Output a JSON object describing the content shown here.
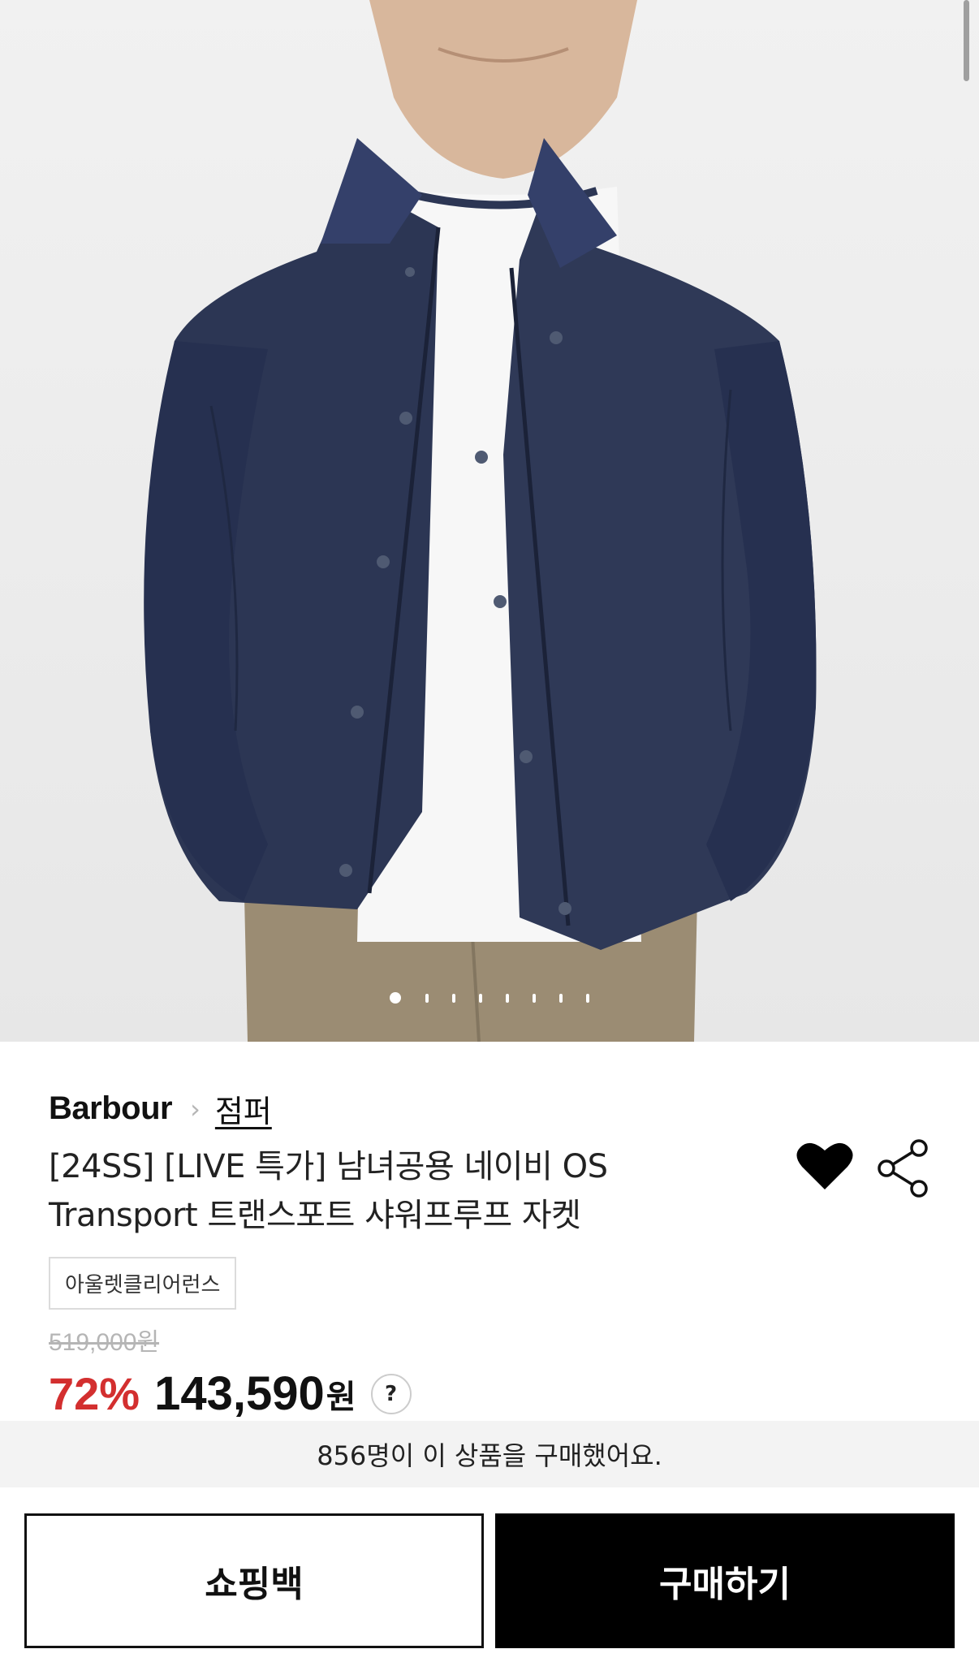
{
  "product": {
    "brand": "Barbour",
    "category": "점퍼",
    "title_line1": "[24SS] [LIVE 특가] 남녀공용 네이비 OS",
    "title_line2": "Transport 트랜스포트 샤워프루프 자켓",
    "tag": "아울렛클리어런스",
    "original_price": "519,000원",
    "discount": "72%",
    "price": "143,590",
    "currency": "원",
    "help_glyph": "?",
    "breadcrumb_separator": "›"
  },
  "gallery": {
    "total_images": 8,
    "current_index": 1
  },
  "social": {
    "buyers_text": "856명이 이 상품을 구매했어요."
  },
  "actions": {
    "bag_label": "쇼핑백",
    "buy_label": "구매하기"
  },
  "icons": {
    "like": "heart-icon",
    "share": "share-icon"
  },
  "colors": {
    "discount": "#d32f2f",
    "buy_button": "#000000",
    "jacket": "#2c3654"
  }
}
